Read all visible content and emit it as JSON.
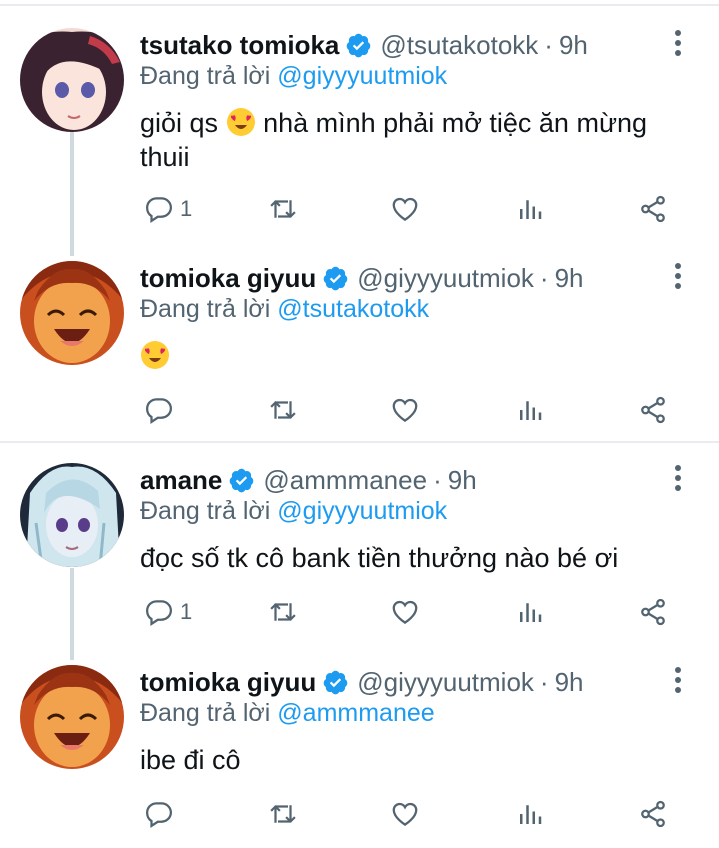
{
  "tweets": [
    {
      "name": "tsutako tomioka",
      "handle": "@tsutakotokk",
      "time": "9h",
      "replying_prefix": "Đang trả lời",
      "replying_to": "@giyyyuutmiok",
      "text_line1": "giỏi qs",
      "text_after_emoji": "nhà mình phải mở tiệc ăn mừng",
      "text_line2": "thuii",
      "reply_count": "1",
      "avatar": "anime-girl-avatar"
    },
    {
      "name": "tomioka giyuu",
      "handle": "@giyyyuutmiok",
      "time": "9h",
      "replying_prefix": "Đang trả lời",
      "replying_to": "@tsutakotokk",
      "text_line1": "",
      "reply_count": "",
      "avatar": "smiling-anime-avatar"
    },
    {
      "name": "amane",
      "handle": "@ammmanee",
      "time": "9h",
      "replying_prefix": "Đang trả lời",
      "replying_to": "@giyyyuutmiok",
      "text_line1": "đọc số tk cô bank tiền thưởng nào bé ơi",
      "reply_count": "1",
      "avatar": "white-hair-anime-avatar"
    },
    {
      "name": "tomioka giyuu",
      "handle": "@giyyyuutmiok",
      "time": "9h",
      "replying_prefix": "Đang trả lời",
      "replying_to": "@ammmanee",
      "text_line1": "ibe đi cô",
      "reply_count": "",
      "avatar": "smiling-anime-avatar"
    }
  ],
  "separator": "·",
  "colors": {
    "link": "#1d9bf0",
    "secondary": "#536471",
    "verified": "#1d9bf0"
  }
}
